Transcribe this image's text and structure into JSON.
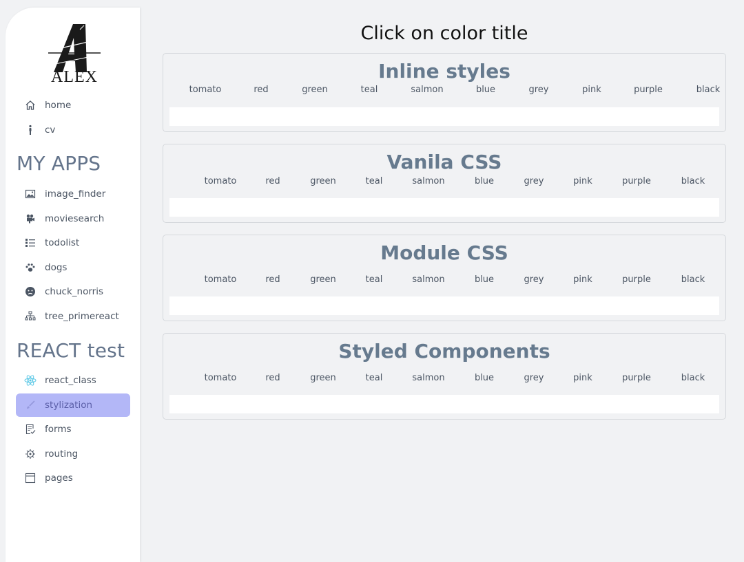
{
  "logo": {
    "text": "ALEX"
  },
  "nav": {
    "main": [
      {
        "label": "home",
        "icon": "home-icon"
      },
      {
        "label": "cv",
        "icon": "person-icon"
      }
    ],
    "my_apps_title": "MY APPS",
    "my_apps": [
      {
        "label": "image_finder",
        "icon": "image-icon"
      },
      {
        "label": "moviesearch",
        "icon": "video-icon"
      },
      {
        "label": "todolist",
        "icon": "list-icon"
      },
      {
        "label": "dogs",
        "icon": "paw-icon"
      },
      {
        "label": "chuck_norris",
        "icon": "face-icon"
      },
      {
        "label": "tree_primereact",
        "icon": "sitemap-icon"
      }
    ],
    "react_test_title": "REACT test",
    "react_test": [
      {
        "label": "react_class",
        "icon": "react-icon"
      },
      {
        "label": "stylization",
        "icon": "brush-icon",
        "active": true
      },
      {
        "label": "forms",
        "icon": "form-icon"
      },
      {
        "label": "routing",
        "icon": "routing-icon"
      },
      {
        "label": "pages",
        "icon": "page-icon"
      }
    ]
  },
  "main": {
    "title": "Click on color title",
    "colors": [
      "tomato",
      "red",
      "green",
      "teal",
      "salmon",
      "blue",
      "grey",
      "pink",
      "purple",
      "black"
    ],
    "cards": [
      {
        "title": "Inline styles"
      },
      {
        "title": "Vanila CSS"
      },
      {
        "title": "Module CSS"
      },
      {
        "title": "Styled Components"
      }
    ]
  },
  "theme": {
    "background": "#f1f2f4",
    "sidebar_bg": "#ffffff",
    "active_item_bg": "#b3b7f7",
    "card_title_color": "#667a8e",
    "section_title_color": "#64748b"
  }
}
